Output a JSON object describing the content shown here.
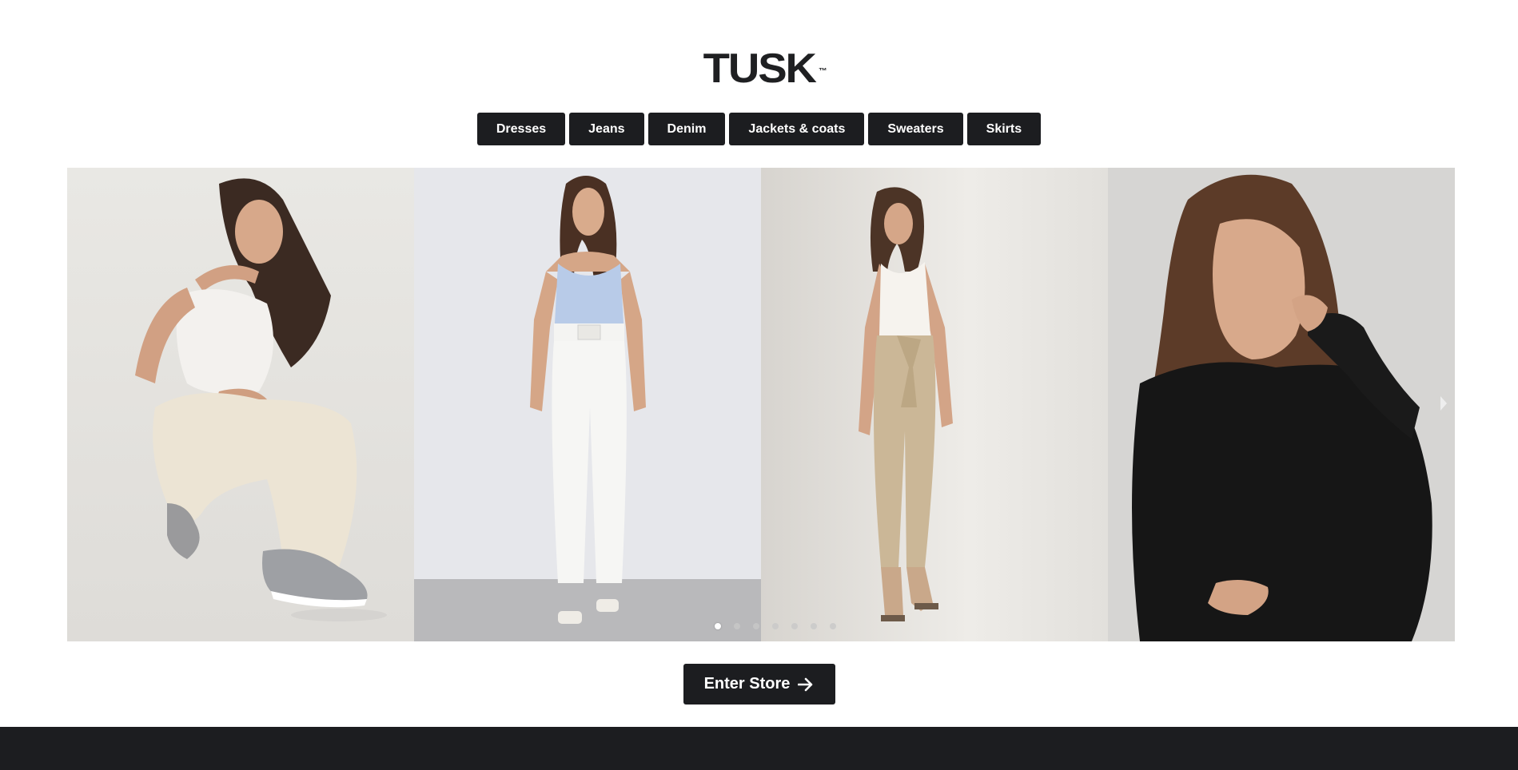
{
  "brand": {
    "logo_text": "TUSK",
    "logo_tm": "™"
  },
  "categories": [
    {
      "label": "Dresses"
    },
    {
      "label": "Jeans"
    },
    {
      "label": "Denim"
    },
    {
      "label": "Jackets & coats"
    },
    {
      "label": "Sweaters"
    },
    {
      "label": "Skirts"
    }
  ],
  "carousel": {
    "slides": [
      {
        "image": "model-crouching-white-tank-cream-joggers"
      },
      {
        "image": "model-blue-bodysuit-white-belted-pants"
      },
      {
        "image": "model-white-tank-beige-paperbag-pants"
      },
      {
        "image": "model-black-sweatshirt-closeup"
      }
    ],
    "dot_count": 7,
    "active_dot": 1,
    "next_icon": "chevron-right-icon"
  },
  "cta": {
    "label": "Enter Store",
    "icon": "arrow-right-icon"
  },
  "colors": {
    "button_bg": "#1c1d20",
    "button_text": "#ffffff",
    "footer_bg": "#1c1d20"
  }
}
